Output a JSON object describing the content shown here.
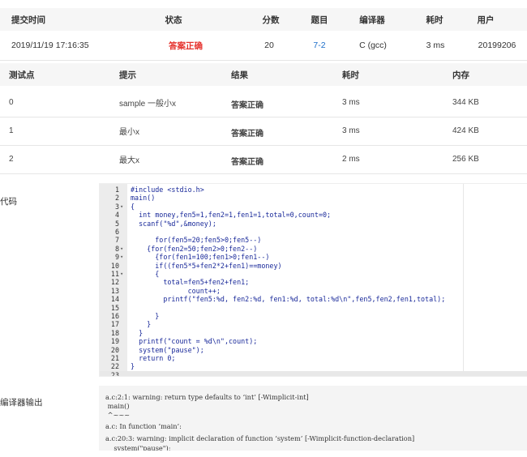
{
  "summary": {
    "headers": [
      "提交时间",
      "状态",
      "分数",
      "题目",
      "编译器",
      "耗时",
      "用户"
    ],
    "row": {
      "time": "2019/11/19 17:16:35",
      "status": "答案正确",
      "score": "20",
      "problem": "7-2",
      "compiler": "C (gcc)",
      "duration": "3 ms",
      "user": "20199206"
    }
  },
  "tests": {
    "headers": [
      "测试点",
      "提示",
      "结果",
      "耗时",
      "内存"
    ],
    "rows": [
      {
        "id": "0",
        "hint": "sample 一般小x",
        "result": "答案正确",
        "time": "3 ms",
        "memory": "344 KB"
      },
      {
        "id": "1",
        "hint": "最小x",
        "result": "答案正确",
        "time": "3 ms",
        "memory": "424 KB"
      },
      {
        "id": "2",
        "hint": "最大x",
        "result": "答案正确",
        "time": "2 ms",
        "memory": "256 KB"
      }
    ]
  },
  "code_label": "代码",
  "code_lines": [
    {
      "n": "1",
      "fold": "",
      "text": "#include <stdio.h>"
    },
    {
      "n": "2",
      "fold": "",
      "text": "main()"
    },
    {
      "n": "3",
      "fold": "▾",
      "text": "{"
    },
    {
      "n": "4",
      "fold": "",
      "text": "  int money,fen5=1,fen2=1,fen1=1,total=0,count=0;"
    },
    {
      "n": "5",
      "fold": "",
      "text": "  scanf(\"%d\",&money);"
    },
    {
      "n": "6",
      "fold": "",
      "text": ""
    },
    {
      "n": "7",
      "fold": "",
      "text": "      for(fen5=20;fen5>0;fen5--)"
    },
    {
      "n": "8",
      "fold": "▾",
      "text": "    {for(fen2=50;fen2>0;fen2--)"
    },
    {
      "n": "9",
      "fold": "▾",
      "text": "      {for(fen1=100;fen1>0;fen1--)"
    },
    {
      "n": "10",
      "fold": "",
      "text": "      if((fen5*5+fen2*2+fen1)==money)"
    },
    {
      "n": "11",
      "fold": "▾",
      "text": "      {"
    },
    {
      "n": "12",
      "fold": "",
      "text": "        total=fen5+fen2+fen1;"
    },
    {
      "n": "13",
      "fold": "",
      "text": "              count++;"
    },
    {
      "n": "14",
      "fold": "",
      "text": "        printf(\"fen5:%d, fen2:%d, fen1:%d, total:%d\\n\",fen5,fen2,fen1,total);"
    },
    {
      "n": "15",
      "fold": "",
      "text": ""
    },
    {
      "n": "16",
      "fold": "",
      "text": "      }"
    },
    {
      "n": "17",
      "fold": "",
      "text": "    }"
    },
    {
      "n": "18",
      "fold": "",
      "text": "  }"
    },
    {
      "n": "19",
      "fold": "",
      "text": "  printf(\"count = %d\\n\",count);"
    },
    {
      "n": "20",
      "fold": "",
      "text": "  system(\"pause\");"
    },
    {
      "n": "21",
      "fold": "",
      "text": "  return 0;"
    },
    {
      "n": "22",
      "fold": "",
      "text": "}"
    },
    {
      "n": "23",
      "fold": "",
      "text": ""
    }
  ],
  "compiler_label": "编译器输出",
  "compiler_output": [
    "a.c:2:1: warning: return type defaults to ‘int’ [-Wimplicit-int]",
    " main()",
    " ^~~~",
    "a.c: In function ‘main’:",
    "a.c:20:3: warning: implicit declaration of function ‘system’ [-Wimplicit-function-declaration]",
    "    system(\"pause\");"
  ],
  "colors": {
    "accepted": "#e5322d",
    "link": "#1a6dc9",
    "header_bg": "#f6f6f6",
    "code_gutter": "#ececec"
  }
}
